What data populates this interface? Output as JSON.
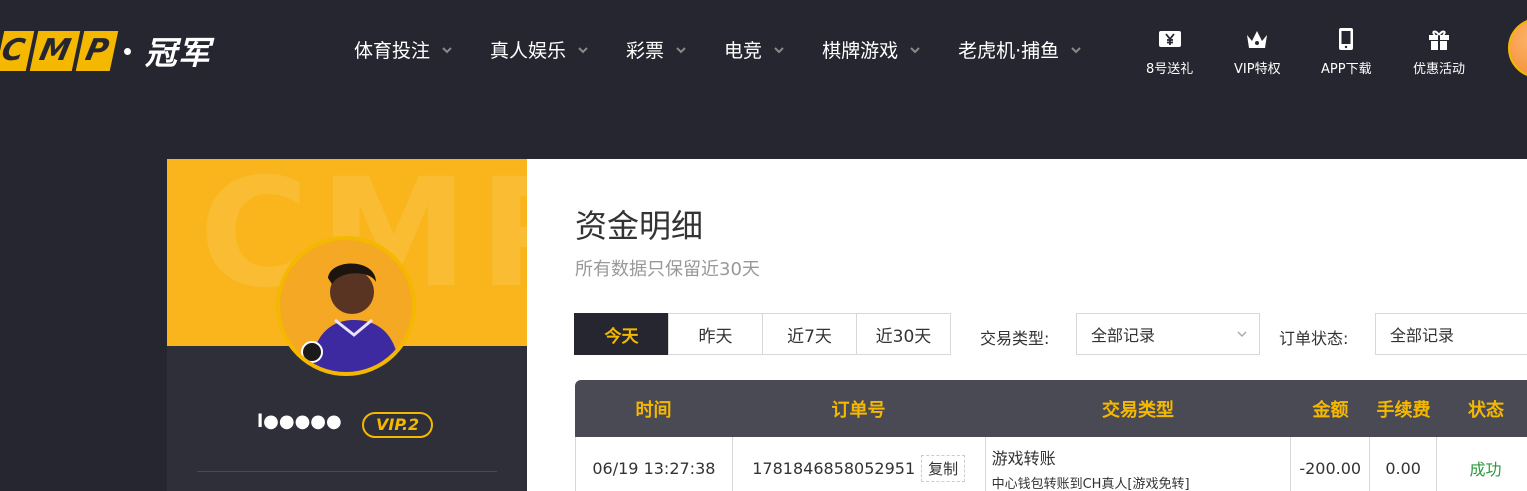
{
  "header": {
    "logo_letters": [
      "C",
      "M",
      "P"
    ],
    "logo_text": "冠军",
    "nav": [
      {
        "label": "体育投注"
      },
      {
        "label": "真人娱乐"
      },
      {
        "label": "彩票"
      },
      {
        "label": "电竞"
      },
      {
        "label": "棋牌游戏"
      },
      {
        "label": "老虎机·捕鱼"
      }
    ],
    "quick_links": [
      {
        "label": "8号送礼",
        "icon": "yen-ticket-icon"
      },
      {
        "label": "VIP特权",
        "icon": "crown-icon"
      },
      {
        "label": "APP下载",
        "icon": "mobile-icon"
      },
      {
        "label": "优惠活动",
        "icon": "gift-icon"
      }
    ]
  },
  "profile": {
    "banner_text": "CMP",
    "username": "l●●●●●",
    "vip": "VIP.2"
  },
  "main": {
    "title": "资金明细",
    "subtitle": "所有数据只保留近30天",
    "tabs": [
      {
        "label": "今天",
        "active": true
      },
      {
        "label": "昨天",
        "active": false
      },
      {
        "label": "近7天",
        "active": false
      },
      {
        "label": "近30天",
        "active": false
      }
    ],
    "filters": {
      "type_label": "交易类型:",
      "type_value": "全部记录",
      "status_label": "订单状态:",
      "status_value": "全部记录"
    },
    "table": {
      "headers": [
        "时间",
        "订单号",
        "交易类型",
        "金额",
        "手续费",
        "状态"
      ],
      "rows": [
        {
          "time": "06/19 13:27:38",
          "order": "1781846858052951",
          "copy": "复制",
          "type": "游戏转账",
          "type_detail": "中心钱包转账到CH真人[游戏免转]",
          "amount": "-200.00",
          "fee": "0.00",
          "status": "成功"
        }
      ]
    }
  },
  "colors": {
    "accent": "#f5b800",
    "dark": "#262630",
    "success": "#2b9a3e"
  }
}
